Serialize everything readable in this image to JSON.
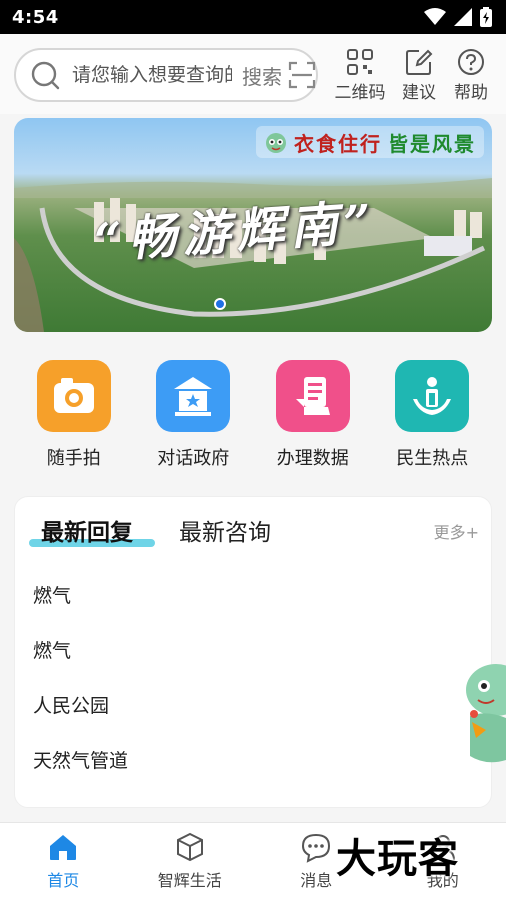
{
  "status_bar": {
    "time": "4:54"
  },
  "search": {
    "placeholder": "请您输入想要查询的内容",
    "button_label": "搜索"
  },
  "header_actions": [
    {
      "label": "二维码",
      "icon": "qrcode-icon"
    },
    {
      "label": "建议",
      "icon": "edit-icon"
    },
    {
      "label": "帮助",
      "icon": "help-icon"
    }
  ],
  "banner": {
    "slogan_left": "衣食住行",
    "slogan_right": "皆是风景",
    "title": "“畅游辉南”"
  },
  "quick_actions": [
    {
      "label": "随手拍",
      "icon": "camera-icon",
      "color": "#f6a02a"
    },
    {
      "label": "对话政府",
      "icon": "government-icon",
      "color": "#3d9cf5"
    },
    {
      "label": "办理数据",
      "icon": "data-icon",
      "color": "#f0508a"
    },
    {
      "label": "民生热点",
      "icon": "people-icon",
      "color": "#1fb7b2"
    }
  ],
  "news": {
    "tab_active": "最新回复",
    "tab_inactive": "最新咨询",
    "more": "更多+",
    "items": [
      "燃气",
      "燃气",
      "人民公园",
      "天然气管道"
    ]
  },
  "bottom_nav": [
    {
      "label": "首页",
      "icon": "home-icon",
      "active": true
    },
    {
      "label": "智辉生活",
      "icon": "box-icon",
      "active": false
    },
    {
      "label": "消息",
      "icon": "message-icon",
      "active": false
    },
    {
      "label": "我的",
      "icon": "user-icon",
      "active": false
    }
  ],
  "watermark": "大玩客",
  "colors": {
    "accent": "#1e88e5",
    "tab_underline": "#6fd4e7"
  }
}
